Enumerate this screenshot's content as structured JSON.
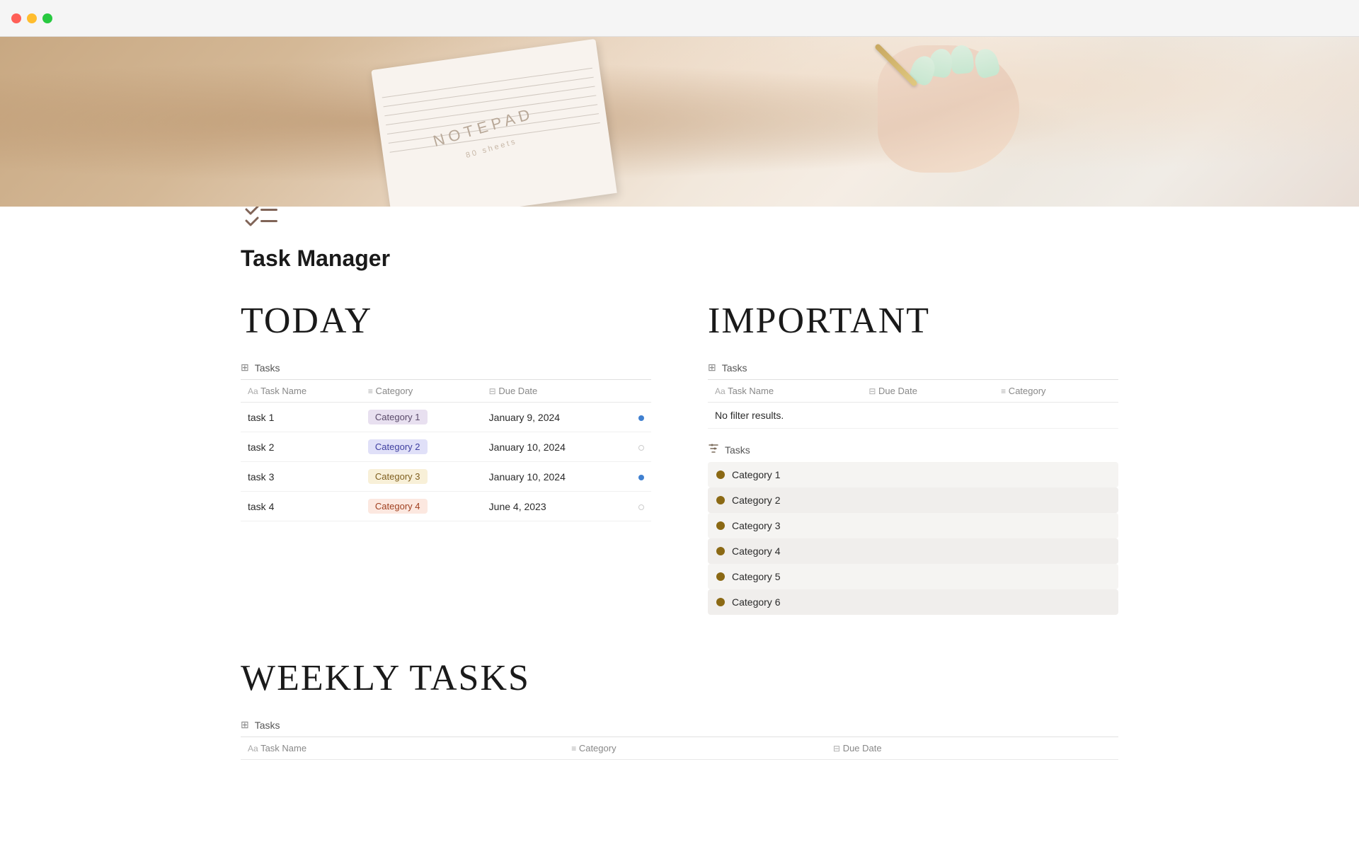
{
  "titlebar": {
    "buttons": [
      "close",
      "minimize",
      "maximize"
    ]
  },
  "hero": {
    "notepad_text": "NOTEPAD",
    "notepad_subtext": "80 sheets"
  },
  "page": {
    "title": "Task Manager",
    "icon_alt": "checklist icon"
  },
  "today_section": {
    "heading": "TODAY",
    "table_label": "Tasks",
    "columns": [
      {
        "icon": "Aa",
        "label": "Task Name"
      },
      {
        "icon": "≡",
        "label": "Category"
      },
      {
        "icon": "⊟",
        "label": "Due Date"
      }
    ],
    "rows": [
      {
        "name": "task 1",
        "category": "Category 1",
        "due_date": "January 9, 2024",
        "badge_class": "badge-cat1"
      },
      {
        "name": "task 2",
        "category": "Category 2",
        "due_date": "January 10, 2024",
        "badge_class": "badge-cat2"
      },
      {
        "name": "task 3",
        "category": "Category 3",
        "due_date": "January 10, 2024",
        "badge_class": "badge-cat3"
      },
      {
        "name": "task 4",
        "category": "Category 4",
        "due_date": "June 4, 2023",
        "badge_class": "badge-cat4"
      }
    ]
  },
  "important_section": {
    "heading": "IMPORTANT",
    "table_label": "Tasks",
    "columns": [
      {
        "icon": "Aa",
        "label": "Task Name"
      },
      {
        "icon": "⊟",
        "label": "Due Date"
      },
      {
        "icon": "≡",
        "label": "Category"
      }
    ],
    "no_results": "No filter results.",
    "category_list_label": "Tasks",
    "categories": [
      "Category 1",
      "Category 2",
      "Category 3",
      "Category 4",
      "Category 5",
      "Category 6"
    ]
  },
  "weekly_section": {
    "heading": "WEEKLY TASKS",
    "table_label": "Tasks",
    "columns": [
      {
        "icon": "Aa",
        "label": "Task Name"
      },
      {
        "icon": "≡",
        "label": "Category"
      },
      {
        "icon": "⊟",
        "label": "Due Date"
      }
    ]
  }
}
